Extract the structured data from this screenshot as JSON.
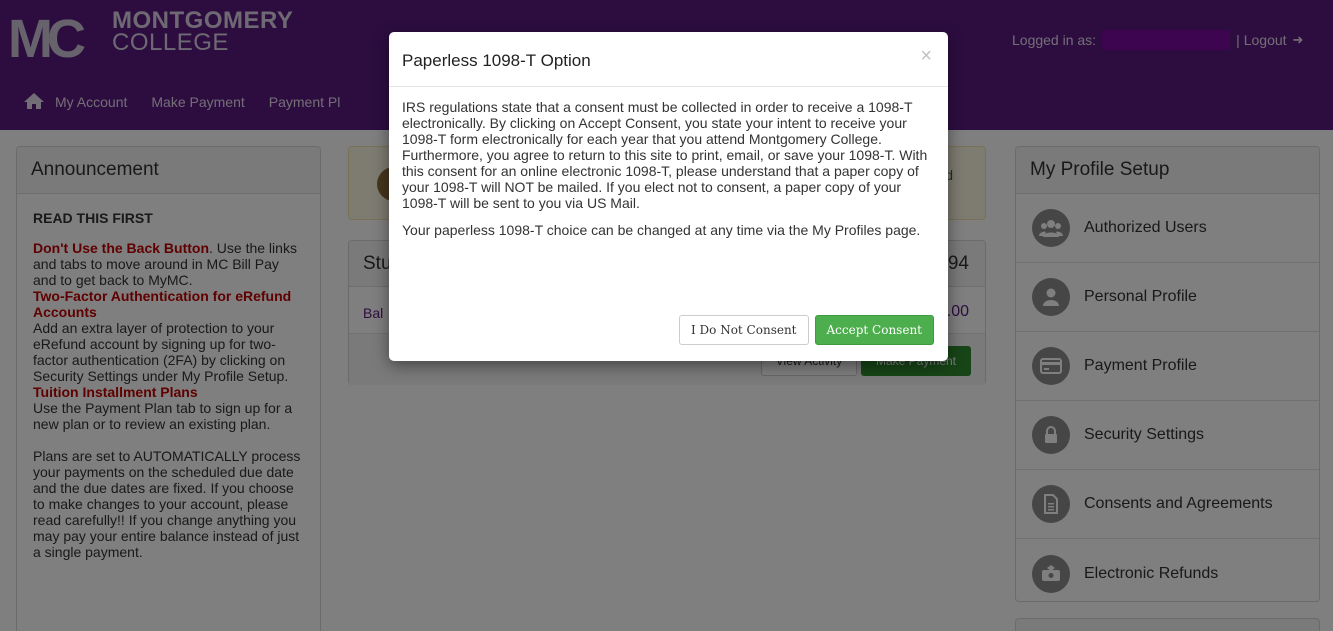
{
  "header": {
    "logo_line1": "MONTGOMERY",
    "logo_line2": "COLLEGE",
    "logo_mark": "MC",
    "nav": [
      "My Account",
      "Make Payment",
      "Payment Pl"
    ],
    "logged_in_label": "Logged in as:",
    "separator": "|",
    "logout": "Logout"
  },
  "announcement": {
    "title": "Announcement",
    "heading": "READ THIS FIRST",
    "back_title": "Don't Use the Back Button",
    "back_text": ". Use the links and tabs to move around in MC Bill Pay and to get back to MyMC.",
    "twofa_title": "Two-Factor Authentication for eRefund Accounts",
    "twofa_text": "Add an extra layer of protection to your eRefund account by signing up for two-factor authentication (2FA) by clicking on Security Settings under My Profile Setup.",
    "tip_title": "Tuition Installment Plans",
    "tip_text": "Use the Payment Plan tab to sign up for a new plan or to review an existing plan.",
    "auto_text": "Plans are set to AUTOMATICALLY process your payments on the scheduled due date and the due dates are fixed. If you choose to make changes to your account, please read carefully!! If you change anything you may pay your entire balance instead of just a single payment."
  },
  "center": {
    "notice_text": "d",
    "account_title": "Stu",
    "account_number": "94",
    "balance_label": "Bal",
    "balance_amount": ".00",
    "view_activity": "View Activity",
    "make_payment": "Make Payment"
  },
  "profile": {
    "title": "My Profile Setup",
    "items": [
      {
        "label": "Authorized Users",
        "icon": "users-icon"
      },
      {
        "label": "Personal Profile",
        "icon": "user-icon"
      },
      {
        "label": "Payment Profile",
        "icon": "credit-card-icon"
      },
      {
        "label": "Security Settings",
        "icon": "lock-icon"
      },
      {
        "label": "Consents and Agreements",
        "icon": "document-icon"
      },
      {
        "label": "Electronic Refunds",
        "icon": "refund-icon"
      }
    ]
  },
  "modal": {
    "title": "Paperless 1098-T Option",
    "close": "×",
    "paragraph1": "IRS regulations state that a consent must be collected in order to receive a 1098-T electronically. By clicking on Accept Consent, you state your intent to receive your 1098-T form electronically for each year that you attend Montgomery College. Furthermore, you agree to return to this site to print, email, or save your 1098-T. With this consent for an online electronic 1098-T, please understand that a paper copy of your 1098-T will NOT be mailed. If you elect not to consent, a paper copy of your 1098-T will be sent to you via US Mail.",
    "paragraph2": "Your paperless 1098-T choice can be changed at any time via the My Profiles page.",
    "decline_label": "I Do Not Consent",
    "accept_label": "Accept Consent"
  },
  "colors": {
    "brand_purple": "#5a1a80",
    "accept_green": "#4cae4c",
    "alert_red": "#c00000"
  }
}
